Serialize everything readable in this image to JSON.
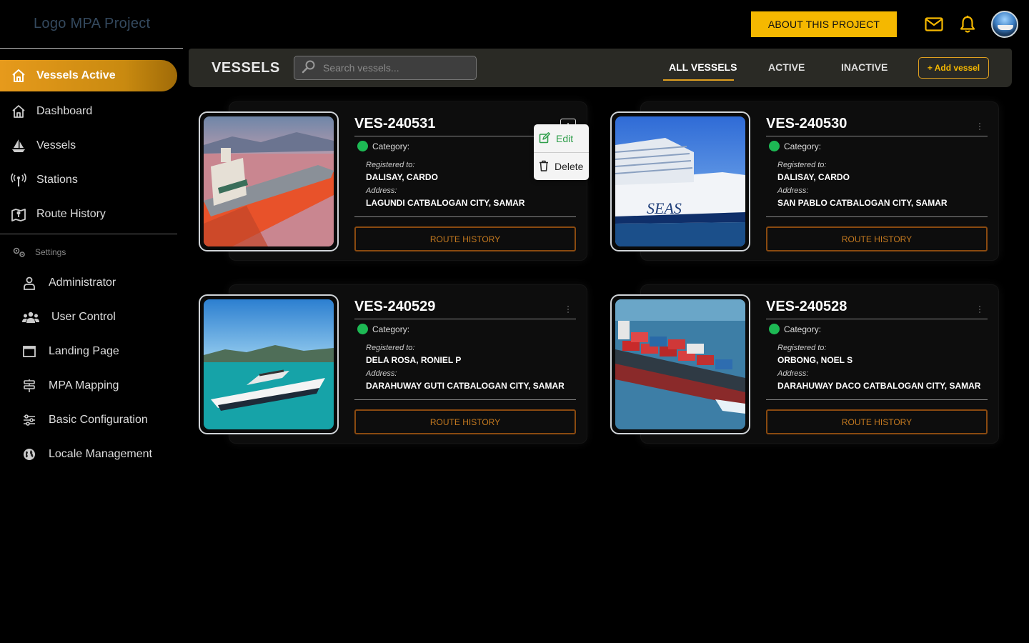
{
  "app": {
    "logo_text": "Logo MPA Project"
  },
  "topbar": {
    "about_label": "ABOUT THIS PROJECT",
    "mail_icon": "mail-icon",
    "bell_icon": "bell-icon",
    "accent_color": "#f5b800"
  },
  "sidebar": {
    "active_item": "Vessels Active",
    "items": [
      {
        "label": "Dashboard",
        "icon": "home-icon"
      },
      {
        "label": "Vessels",
        "icon": "sailboat-icon"
      },
      {
        "label": "Stations",
        "icon": "antenna-icon"
      },
      {
        "label": "Route History",
        "icon": "map-pin-icon"
      }
    ],
    "settings_label": "Settings",
    "settings_items": [
      {
        "label": "Administrator",
        "icon": "user-icon"
      },
      {
        "label": "User Control",
        "icon": "users-icon"
      },
      {
        "label": "Landing Page",
        "icon": "window-icon"
      },
      {
        "label": "MPA Mapping",
        "icon": "signpost-icon"
      },
      {
        "label": "Basic Configuration",
        "icon": "sliders-icon"
      },
      {
        "label": "Locale Management",
        "icon": "globe-icon"
      }
    ]
  },
  "vessels_header": {
    "title": "VESSELS",
    "search_placeholder": "Search vessels...",
    "tabs": [
      "ALL VESSELS",
      "ACTIVE",
      "INACTIVE"
    ],
    "active_tab": "ALL VESSELS",
    "add_label": "+ Add vessel"
  },
  "cards": [
    {
      "id": "VES-240531",
      "category_label": "Category:",
      "status_color": "#1db954",
      "registered_label": "Registered to:",
      "registered_to": "DALISAY, CARDO",
      "address_label": "Address:",
      "address": "LAGUNDI CATBALOGAN CITY, SAMAR",
      "route_label": "ROUTE HISTORY",
      "image": "cargo-ship-ice"
    },
    {
      "id": "VES-240530",
      "category_label": "Category:",
      "status_color": "#1db954",
      "registered_label": "Registered to:",
      "registered_to": "DALISAY, CARDO",
      "address_label": "Address:",
      "address": "SAN PABLO CATBALOGAN CITY, SAMAR",
      "route_label": "ROUTE HISTORY",
      "image": "cruise-ship"
    },
    {
      "id": "VES-240529",
      "category_label": "Category:",
      "status_color": "#1db954",
      "registered_label": "Registered to:",
      "registered_to": "DELA ROSA, RONIEL P",
      "address_label": "Address:",
      "address": "DARAHUWAY GUTI CATBALOGAN CITY, SAMAR",
      "route_label": "ROUTE HISTORY",
      "image": "speedboat"
    },
    {
      "id": "VES-240528",
      "category_label": "Category:",
      "status_color": "#1db954",
      "registered_label": "Registered to:",
      "registered_to": "ORBONG, NOEL S",
      "address_label": "Address:",
      "address": "DARAHUWAY DACO CATBALOGAN CITY, SAMAR",
      "route_label": "ROUTE HISTORY",
      "image": "container-ship"
    }
  ],
  "context_menu": {
    "edit_label": "Edit",
    "delete_label": "Delete"
  }
}
